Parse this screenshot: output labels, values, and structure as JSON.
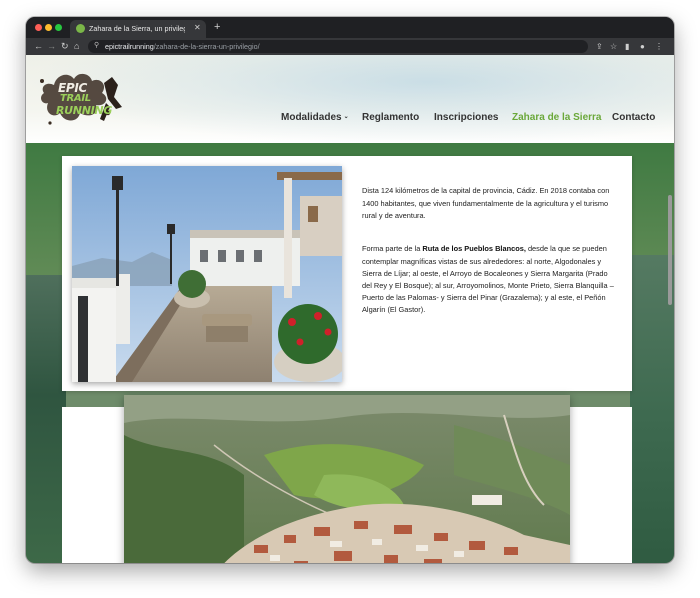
{
  "browser": {
    "tab_title": "Zahara de la Sierra, un privilegio",
    "url_host": "epictrailrunning",
    "url_path": "/zahara-de-la-sierra-un-privilegio/"
  },
  "site": {
    "logo_lines": [
      "EPIC",
      "TRAIL",
      "RUNNING"
    ],
    "nav": [
      {
        "label": "Modalidades"
      },
      {
        "label": "Reglamento"
      },
      {
        "label": "Inscripciones"
      },
      {
        "label": "Zahara de la Sierra"
      },
      {
        "label": "Contacto"
      }
    ]
  },
  "content": {
    "p1": "Dista 124 kilómetros de la capital de provincia, Cádiz. En 2018 contaba con 1400 habitantes, que viven fundamentalmente de la agricultura y el turismo rural y de aventura.",
    "p2_prefix": "Forma parte de la ",
    "p2_bold": "Ruta de los Pueblos Blancos,",
    "p2_rest": " desde la que se pueden contemplar magníficas vistas de sus alrededores: al norte, Algodonales y Sierra de Líjar; al oeste, el Arroyo de Bocaleones y Sierra Margarita (Prado del Rey y El Bosque); al sur, Arroyomolinos, Monte Prieto, Sierra Blanquilla – Puerto de las Palomas- y Sierra del Pinar (Grazalema); y al este, el Peñón Algarín (El Gastor)."
  },
  "colors": {
    "accent": "#6aa83a",
    "nav_text": "#333333"
  }
}
